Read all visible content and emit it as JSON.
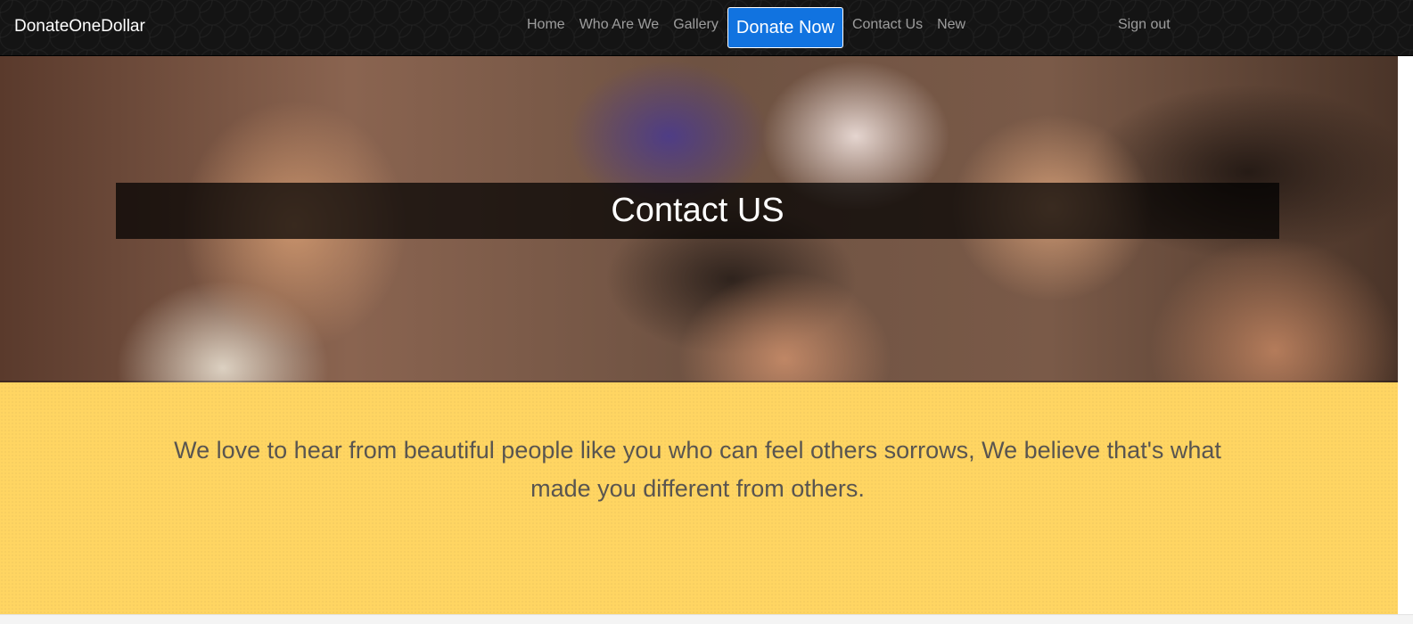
{
  "navbar": {
    "brand": "DonateOneDollar",
    "links": {
      "home": "Home",
      "who": "Who Are We",
      "gallery": "Gallery",
      "donate": "Donate Now",
      "contact": "Contact Us",
      "new": "New"
    },
    "signout": "Sign out"
  },
  "hero": {
    "title": "Contact US"
  },
  "message": {
    "text": "We love to hear from beautiful people like you who can feel others sorrows, We believe that's what made you different from others."
  },
  "colors": {
    "navbar_bg": "#141414",
    "donate_button": "#1173e0",
    "section_bg": "#ffd562",
    "body_text": "#595550"
  }
}
